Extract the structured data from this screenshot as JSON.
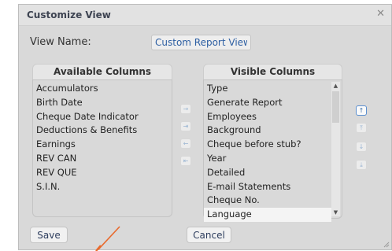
{
  "dialog": {
    "title": "Customize View",
    "close_icon": "close-icon"
  },
  "view_name": {
    "label": "View Name:",
    "value": "Custom Report View"
  },
  "available": {
    "header": "Available Columns",
    "items": [
      "Accumulators",
      "Birth Date",
      "Cheque Date Indicator",
      "Deductions & Benefits",
      "Earnings",
      "REV CAN",
      "REV QUE",
      "S.I.N."
    ]
  },
  "visible": {
    "header": "Visible Columns",
    "items": [
      "Type",
      "Generate Report",
      "Employees",
      "Background",
      "Cheque before stub?",
      "Year",
      "Detailed",
      "E-mail Statements",
      "Cheque No.",
      "Language"
    ],
    "selected": "Language"
  },
  "transfer_buttons": [
    {
      "name": "move-right-icon",
      "glyph": "→"
    },
    {
      "name": "move-all-right-icon",
      "glyph": "⇥"
    },
    {
      "name": "move-left-icon",
      "glyph": "←"
    },
    {
      "name": "move-all-left-icon",
      "glyph": "⇤"
    }
  ],
  "order_buttons": [
    {
      "name": "move-up-icon",
      "glyph": "↑"
    },
    {
      "name": "move-top-icon",
      "glyph": "⤒"
    },
    {
      "name": "move-down-icon",
      "glyph": "↓"
    },
    {
      "name": "move-bottom-icon",
      "glyph": "⤓"
    }
  ],
  "actions": {
    "save_label": "Save",
    "cancel_label": "Cancel"
  },
  "colors": {
    "annotation_arrow": "#e8692c",
    "active_button": "#5b8fd0"
  }
}
